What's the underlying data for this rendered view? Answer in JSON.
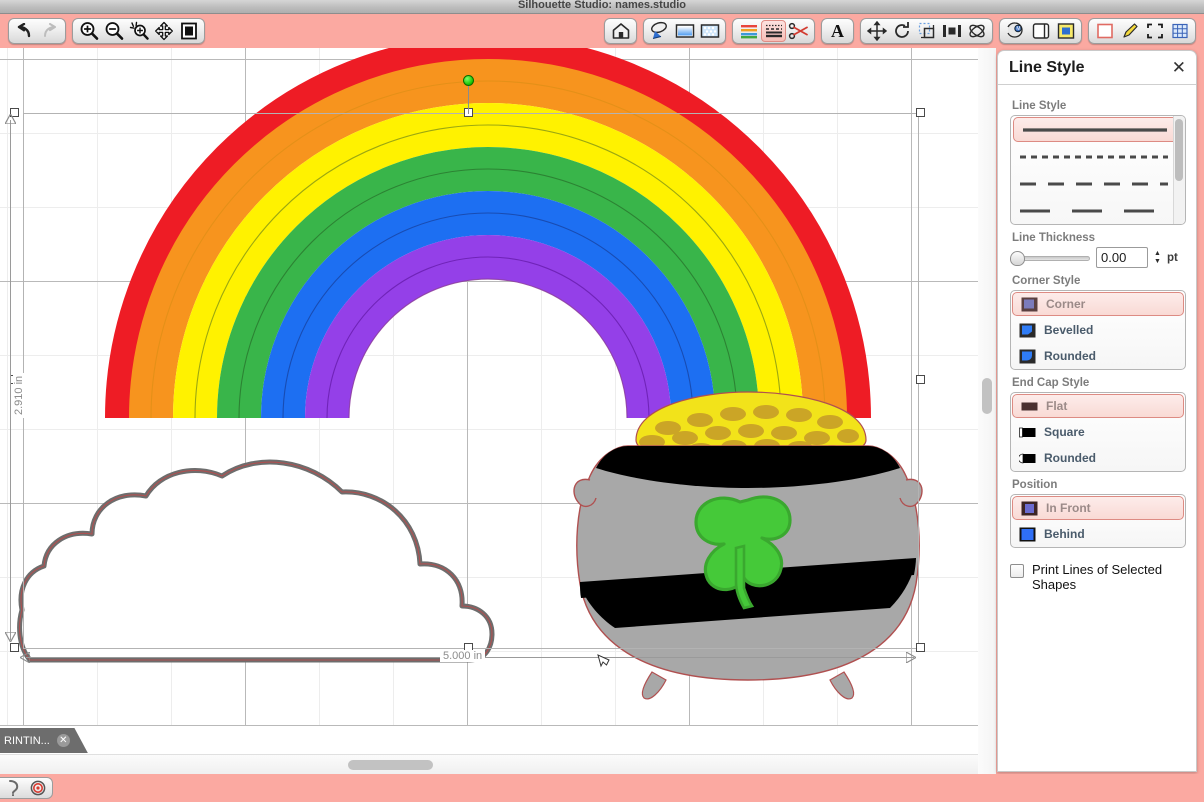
{
  "window": {
    "title": "Silhouette Studio: names.studio"
  },
  "toolbar": {
    "groups": [
      {
        "name": "history",
        "buttons": [
          {
            "id": "undo",
            "label": "Undo",
            "icon": "undo-icon",
            "selected": false
          },
          {
            "id": "redo",
            "label": "Redo",
            "icon": "redo-icon",
            "selected": false
          }
        ]
      },
      {
        "name": "zoom",
        "buttons": [
          {
            "id": "zoom-in",
            "label": "Zoom In",
            "icon": "zoom-in-icon",
            "selected": false
          },
          {
            "id": "zoom-out",
            "label": "Zoom Out",
            "icon": "zoom-out-icon",
            "selected": false
          },
          {
            "id": "zoom-selection",
            "label": "Zoom to Selection",
            "icon": "zoom-selection-icon",
            "selected": false
          },
          {
            "id": "pan",
            "label": "Pan",
            "icon": "pan-icon",
            "selected": false
          },
          {
            "id": "fit-to-page",
            "label": "Fit To Page",
            "icon": "fit-page-icon",
            "selected": false
          }
        ]
      },
      {
        "name": "home",
        "buttons": [
          {
            "id": "library",
            "label": "Library",
            "icon": "house-icon",
            "selected": false
          }
        ]
      },
      {
        "name": "design-view",
        "buttons": [
          {
            "id": "design-page",
            "label": "Design Page Settings",
            "icon": "page-setup-icon",
            "selected": false
          },
          {
            "id": "page-color",
            "label": "Page Color",
            "icon": "page-color-icon",
            "selected": false
          },
          {
            "id": "page-texture",
            "label": "Page Texture",
            "icon": "page-texture-icon",
            "selected": false
          }
        ]
      },
      {
        "name": "style",
        "buttons": [
          {
            "id": "fill-style",
            "label": "Fill Style",
            "icon": "fill-style-icon",
            "selected": false
          },
          {
            "id": "line-style",
            "label": "Line Style",
            "icon": "line-style-icon",
            "selected": true
          },
          {
            "id": "cut-settings",
            "label": "Cut Settings",
            "icon": "scissors-icon",
            "selected": false
          }
        ]
      },
      {
        "name": "text",
        "buttons": [
          {
            "id": "text-style",
            "label": "Text Style",
            "icon": "letter-a-icon",
            "selected": false
          }
        ]
      },
      {
        "name": "transform",
        "buttons": [
          {
            "id": "move",
            "label": "Move",
            "icon": "move-arrows-icon",
            "selected": false
          },
          {
            "id": "rotate",
            "label": "Rotate",
            "icon": "rotate-icon",
            "selected": false
          },
          {
            "id": "scale",
            "label": "Scale",
            "icon": "scale-icon",
            "selected": false
          },
          {
            "id": "align",
            "label": "Align",
            "icon": "align-icon",
            "selected": false
          },
          {
            "id": "replicate",
            "label": "Replicate",
            "icon": "replicate-icon",
            "selected": false
          }
        ]
      },
      {
        "name": "modify",
        "buttons": [
          {
            "id": "modify",
            "label": "Modify",
            "icon": "modify-icon",
            "selected": false
          },
          {
            "id": "offset",
            "label": "Offset",
            "icon": "offset-icon",
            "selected": false
          },
          {
            "id": "trace",
            "label": "Trace",
            "icon": "trace-icon",
            "selected": false
          }
        ]
      },
      {
        "name": "print",
        "buttons": [
          {
            "id": "registration-marks",
            "label": "Registration Marks",
            "icon": "reg-marks-icon",
            "selected": false
          },
          {
            "id": "sketch",
            "label": "Sketch Pens",
            "icon": "pen-icon",
            "selected": false
          },
          {
            "id": "print-bleed",
            "label": "Print Bleed",
            "icon": "crop-marks-icon",
            "selected": false
          },
          {
            "id": "grid-settings",
            "label": "Grid Settings",
            "icon": "grid-icon",
            "selected": false
          }
        ]
      }
    ]
  },
  "canvas": {
    "selection": {
      "width_label": "5.000 in",
      "height_label": "2.910 in"
    },
    "artwork": {
      "name": "rainbow-pot-of-gold",
      "rainbow_colors": [
        "#ee1c25",
        "#f7941e",
        "#fff200",
        "#39b54a",
        "#1d6ff2",
        "#9440e8"
      ],
      "cloud_fill": "#ffffff",
      "cloud_stroke": "#6d6d6d",
      "pot_fill": "#a8a8a8",
      "pot_band": "#000000",
      "gold_fill": "#f2e31a",
      "gold_coin": "#c9a227",
      "shamrock_fill": "#45c939",
      "shamrock_stroke": "#3aa82f",
      "cut_line_color": "#b05050"
    }
  },
  "tabs": {
    "documents": [
      {
        "label": "RINTIN...",
        "close_icon": "close-icon",
        "active": true
      }
    ]
  },
  "panel": {
    "title": "Line Style",
    "close_icon": "close-icon",
    "sections": {
      "line_style": {
        "label": "Line Style",
        "options": [
          {
            "id": "solid",
            "pattern": "solid",
            "selected": true
          },
          {
            "id": "dashed-fine",
            "pattern": "6 5",
            "selected": false
          },
          {
            "id": "dashed-medium",
            "pattern": "16 12",
            "selected": false
          },
          {
            "id": "dashed-long",
            "pattern": "30 22",
            "selected": false
          }
        ]
      },
      "line_thickness": {
        "label": "Line Thickness",
        "value": "0.00",
        "unit": "pt",
        "slider_percent": 0
      },
      "corner_style": {
        "label": "Corner Style",
        "options": [
          {
            "label": "Corner",
            "icon": "corner-square-icon",
            "selected": true
          },
          {
            "label": "Bevelled",
            "icon": "corner-bevel-icon",
            "selected": false
          },
          {
            "label": "Rounded",
            "icon": "corner-rounded-icon",
            "selected": false
          }
        ]
      },
      "end_cap_style": {
        "label": "End Cap Style",
        "options": [
          {
            "label": "Flat",
            "icon": "cap-flat-icon",
            "selected": true
          },
          {
            "label": "Square",
            "icon": "cap-square-icon",
            "selected": false
          },
          {
            "label": "Rounded",
            "icon": "cap-rounded-icon",
            "selected": false
          }
        ]
      },
      "position": {
        "label": "Position",
        "options": [
          {
            "label": "In Front",
            "icon": "position-front-icon",
            "selected": true
          },
          {
            "label": "Behind",
            "icon": "position-behind-icon",
            "selected": false
          }
        ]
      },
      "print_lines": {
        "label": "Print Lines of Selected Shapes",
        "checked": false
      }
    }
  },
  "statusbar": {
    "buttons": [
      {
        "id": "help",
        "label": "Help",
        "icon": "help-icon"
      },
      {
        "id": "registration",
        "label": "Registration",
        "icon": "target-icon"
      }
    ]
  },
  "colors": {
    "chrome": "#fba9a1",
    "accent_selected": "#f9dad5",
    "accent_border": "#dd8b83"
  }
}
